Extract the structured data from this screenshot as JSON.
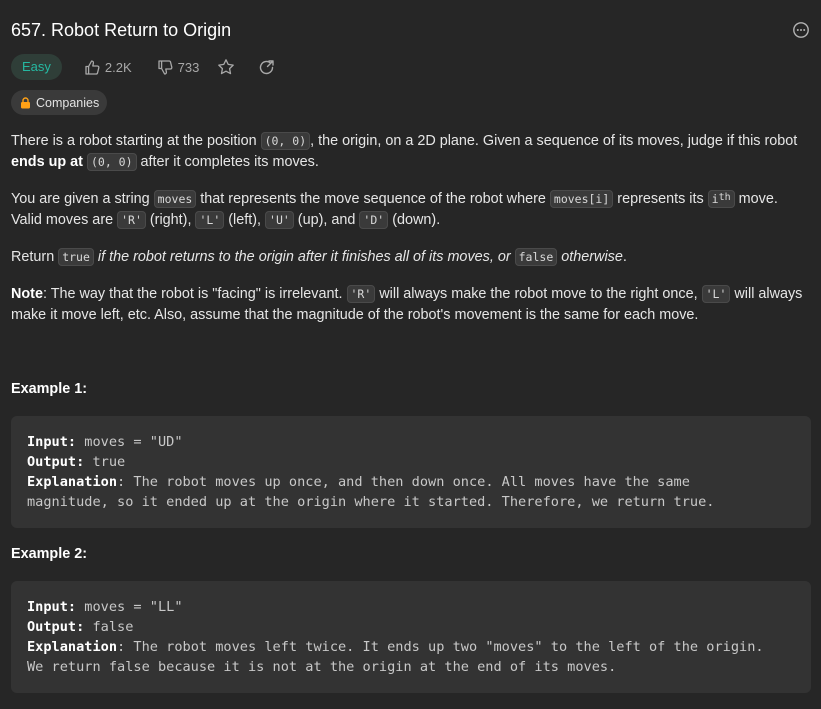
{
  "problem": {
    "title": "657. Robot Return to Origin",
    "difficulty": "Easy",
    "likes": "2.2K",
    "dislikes": "733",
    "companies_label": "Companies"
  },
  "description": {
    "p1": {
      "t1": "There is a robot starting at the position ",
      "c1": "(0, 0)",
      "t2": ", the origin, on a 2D plane. Given a sequence of its moves, judge if this robot ",
      "b1": "ends up at",
      "c2": "(0, 0)",
      "t3": " after it completes its moves."
    },
    "p2": {
      "t1": "You are given a string ",
      "c1": "moves",
      "t2": " that represents the move sequence of the robot where ",
      "c2": "moves[i]",
      "t3": " represents its ",
      "c3_base": "i",
      "c3_sup": "th",
      "t4": " move. Valid moves are ",
      "c4": "'R'",
      "t5": " (right), ",
      "c5": "'L'",
      "t6": " (left), ",
      "c6": "'U'",
      "t7": " (up), and ",
      "c7": "'D'",
      "t8": " (down)."
    },
    "p3": {
      "t1": "Return ",
      "c1": "true",
      "i1": " if the robot returns to the origin after it finishes all of its moves, or ",
      "c2": "false",
      "i2": " otherwise"
    },
    "p4": {
      "b1": "Note",
      "t1": ": The way that the robot is \"facing\" is irrelevant. ",
      "c1": "'R'",
      "t2": " will always make the robot move to the right once, ",
      "c2": "'L'",
      "t3": " will always make it move left, etc. Also, assume that the magnitude of the robot's movement is the same for each move."
    }
  },
  "examples": [
    {
      "title": "Example 1:",
      "input_label": "Input:",
      "input": " moves = \"UD\"",
      "output_label": "Output:",
      "output": " true",
      "explanation_label": "Explanation",
      "explanation_1": ": The robot moves up once, and then down once. All moves have the same",
      "explanation_2": "magnitude, so it ended up at the origin where it started. Therefore, we return true."
    },
    {
      "title": "Example 2:",
      "input_label": "Input:",
      "input": " moves = \"LL\"",
      "output_label": "Output:",
      "output": " false",
      "explanation_label": "Explanation",
      "explanation_1": ": The robot moves left twice. It ends up two \"moves\" to the left of the origin.",
      "explanation_2": "We return false because it is not at the origin at the end of its moves."
    }
  ],
  "colors": {
    "background": "#262626",
    "easy": "#25b8a1",
    "code_bg": "#333333"
  },
  "icons": {
    "more": "more-circle-icon",
    "like": "thumbs-up-icon",
    "dislike": "thumbs-down-icon",
    "favorite": "star-icon",
    "share": "share-icon",
    "lock": "lock-icon"
  }
}
